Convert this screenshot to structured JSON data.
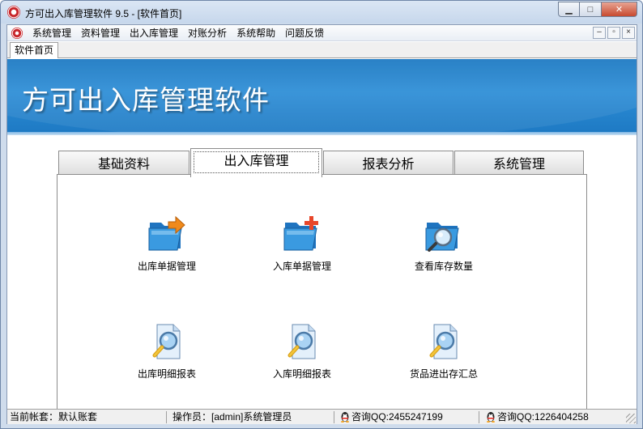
{
  "window": {
    "title": "方可出入库管理软件 9.5 - [软件首页]",
    "controls": {
      "minimize": "▁",
      "maximize": "□",
      "close": "✕"
    }
  },
  "menubar": {
    "items": [
      "系统管理",
      "资料管理",
      "出入库管理",
      "对账分析",
      "系统帮助",
      "问题反馈"
    ],
    "mdi_controls": {
      "minimize": "–",
      "restore": "▫",
      "close": "×"
    }
  },
  "doc_tab": "软件首页",
  "banner": {
    "title": "方可出入库管理软件"
  },
  "module_tabs": {
    "items": [
      "基础资料",
      "出入库管理",
      "报表分析",
      "系统管理"
    ],
    "active_index": 1
  },
  "features": [
    {
      "label": "出库单据管理",
      "icon": "folder-arrow-icon"
    },
    {
      "label": "入库单据管理",
      "icon": "folder-plus-icon"
    },
    {
      "label": "查看库存数量",
      "icon": "folder-magnifier-icon"
    },
    {
      "label": "出库明细报表",
      "icon": "document-magnifier-icon"
    },
    {
      "label": "入库明细报表",
      "icon": "document-magnifier-icon"
    },
    {
      "label": "货品进出存汇总",
      "icon": "document-magnifier-icon"
    }
  ],
  "statusbar": {
    "account": "当前帐套：默认账套",
    "operator": "操作员：[admin]系统管理员",
    "qq1": "咨询QQ:2455247199",
    "qq2": "咨询QQ:1226404258"
  },
  "colors": {
    "banner": "#1f7dc6",
    "folder": "#2f8fd8",
    "arrow": "#f08a1c",
    "plus": "#e8462a"
  }
}
